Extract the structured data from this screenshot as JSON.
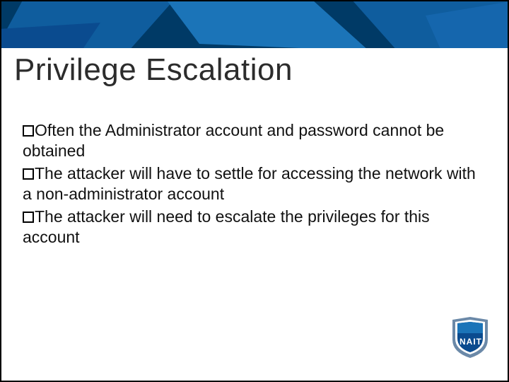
{
  "slide": {
    "title": "Privilege Escalation",
    "bullets": [
      "Often the Administrator account and password cannot be obtained",
      "The attacker will have to settle for accessing the network with a non-administrator account",
      "The attacker will need to escalate the privileges for this account"
    ]
  },
  "logo": {
    "text": "NAIT"
  },
  "colors": {
    "banner_base": "#003a66",
    "banner_light": "#1b74b8",
    "banner_mid": "#0f5d9e",
    "shield_outer": "#6b89a8",
    "shield_inner": "#0a4b8f"
  }
}
